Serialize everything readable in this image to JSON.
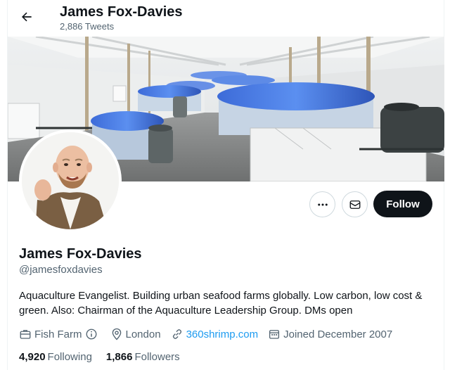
{
  "header": {
    "name": "James Fox-Davies",
    "tweet_count": "2,886 Tweets"
  },
  "actions": {
    "more_icon": "ellipsis-icon",
    "message_icon": "envelope-icon",
    "follow_label": "Follow"
  },
  "profile": {
    "name": "James Fox-Davies",
    "handle": "@jamesfoxdavies",
    "bio": "Aquaculture Evangelist. Building urban seafood farms globally. Low carbon, low cost & green. Also: Chairman of the Aquaculture Leadership Group.  DMs open",
    "category": "Fish Farm",
    "location": "London",
    "website": "360shrimp.com",
    "joined": "Joined December 2007"
  },
  "stats": {
    "following_count": "4,920",
    "following_label": "Following",
    "followers_count": "1,866",
    "followers_label": "Followers"
  },
  "colors": {
    "link": "#1d9bf0",
    "muted": "#536471",
    "follow_bg": "#0f1419"
  }
}
